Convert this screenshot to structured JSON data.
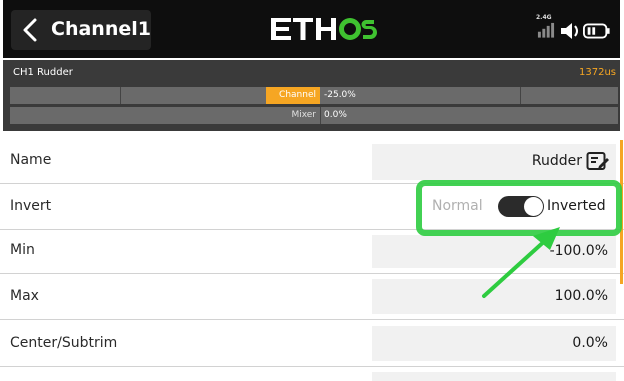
{
  "header": {
    "title": "Channel1",
    "logo_text": "ETHOS",
    "signal_label": "2.4G",
    "colors": {
      "logo_white": "#ffffff",
      "logo_green": "#3fc230"
    }
  },
  "monitor": {
    "channel_name": "CH1 Rudder",
    "pulse": "1372us",
    "channel_label": "Channel",
    "channel_value": "-25.0%",
    "mixer_label": "Mixer",
    "mixer_value": "0.0%"
  },
  "rows": {
    "name": {
      "label": "Name",
      "value": "Rudder"
    },
    "invert": {
      "label": "Invert",
      "off_label": "Normal",
      "on_label": "Inverted",
      "state": "on"
    },
    "min": {
      "label": "Min",
      "value": "-100.0%"
    },
    "max": {
      "label": "Max",
      "value": "100.0%"
    },
    "center": {
      "label": "Center/Subtrim",
      "value": "0.0%"
    }
  },
  "annotation": {
    "highlight_color": "#2ecc40",
    "arrow_color": "#2ecc40"
  }
}
